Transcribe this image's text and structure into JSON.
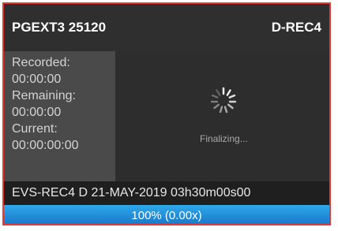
{
  "header": {
    "clip_id": "PGEXT3  25120",
    "recorder": "D-REC4"
  },
  "status": {
    "recorded_label": "Recorded:",
    "recorded_value": "00:00:00",
    "remaining_label": "Remaining:",
    "remaining_value": "00:00:00",
    "current_label": "Current:",
    "current_value": "00:00:00:00"
  },
  "preview": {
    "message": "Finalizing...",
    "icon": "loading-spinner-icon"
  },
  "clip_info": "EVS-REC4 D 21-MAY-2019 03h30m00s00",
  "progress": {
    "percent": 100,
    "label": "100% (0.00x)"
  },
  "colors": {
    "border_accent": "#e53935",
    "progress_blue": "#1976c9"
  }
}
